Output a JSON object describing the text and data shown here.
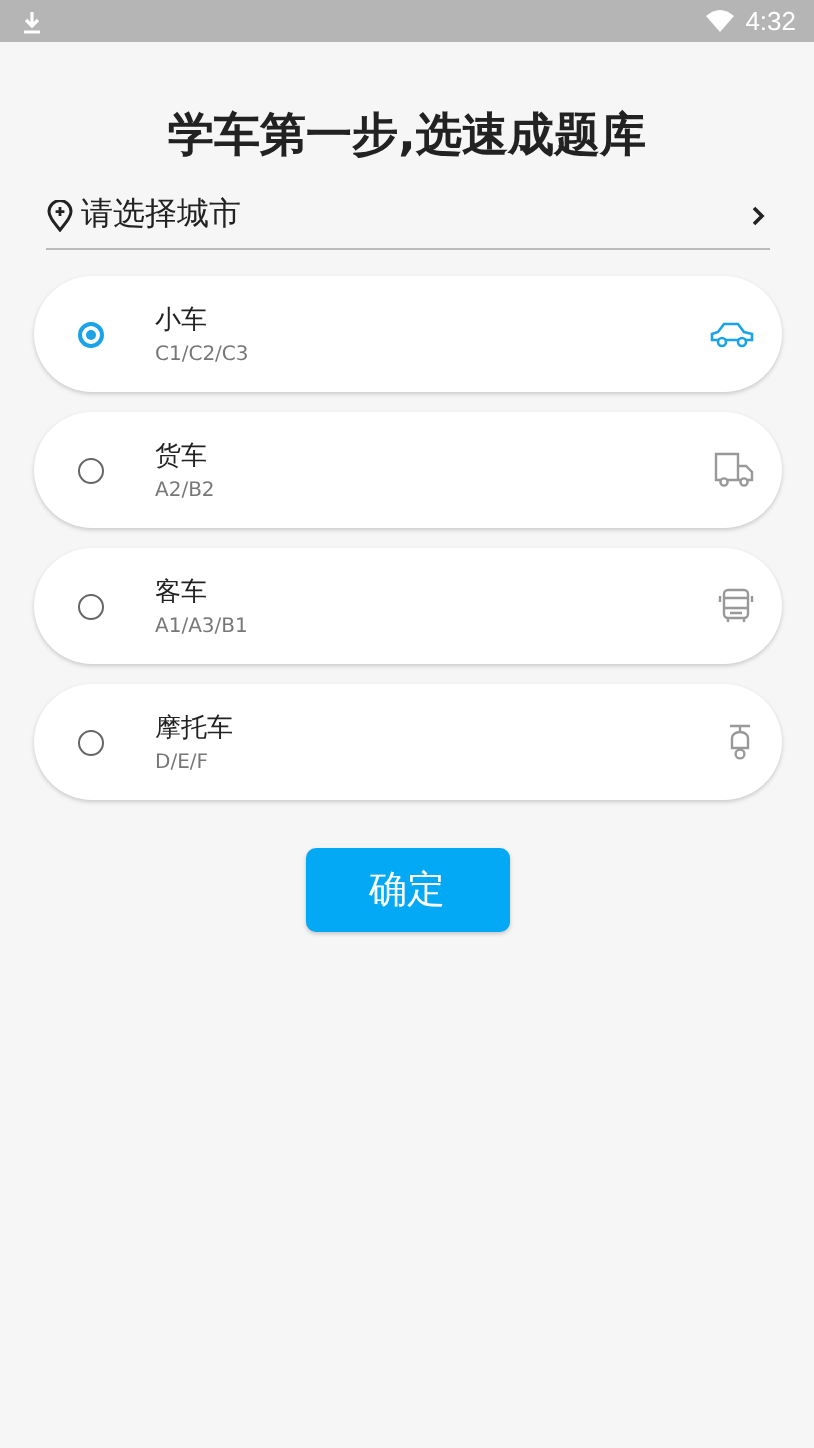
{
  "status_bar": {
    "time": "4:32"
  },
  "title": "学车第一步,选速成题库",
  "city": {
    "placeholder": "请选择城市"
  },
  "vehicles": [
    {
      "kind": "car",
      "name": "小车",
      "licenses": "C1/C2/C3",
      "selected": true
    },
    {
      "kind": "truck",
      "name": "货车",
      "licenses": "A2/B2",
      "selected": false
    },
    {
      "kind": "bus",
      "name": "客车",
      "licenses": "A1/A3/B1",
      "selected": false
    },
    {
      "kind": "motorcycle",
      "name": "摩托车",
      "licenses": "D/E/F",
      "selected": false
    }
  ],
  "confirm": "确定"
}
